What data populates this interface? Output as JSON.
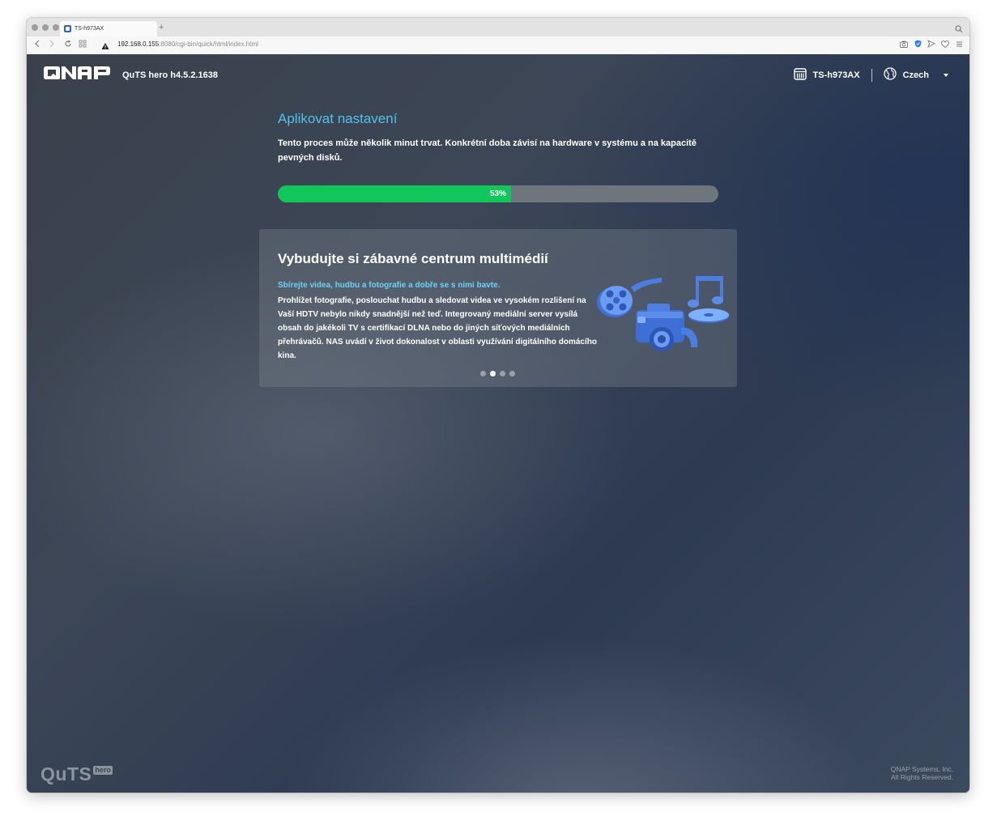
{
  "browser": {
    "tab_title": "TS-h973AX",
    "new_tab": "+",
    "url_host": "192.168.0.155",
    "url_rest": ":8080/cgi-bin/quick/html/index.html"
  },
  "header": {
    "version": "QuTS hero h4.5.2.1638",
    "device_name": "TS-h973AX",
    "language": "Czech"
  },
  "setup": {
    "title": "Aplikovat nastavení",
    "description": "Tento proces může několik minut trvat. Konkrétní doba závisí na hardware v systému a na kapacitě pevných disků.",
    "progress_percent": 53,
    "progress_label": "53%"
  },
  "carousel": {
    "title": "Vybudujte si zábavné centrum multimédií",
    "subtitle": "Sbírejte videa, hudbu a fotografie a dobře se s nimi bavte.",
    "body": "Prohlížet fotografie, poslouchat hudbu a sledovat videa ve vysokém rozlišení na Vaší HDTV nebylo nikdy snadnější než teď. Integrovaný mediální server vysílá obsah do jakékoli TV s certifikací DLNA nebo do jiných síťových mediálních přehrávačů. NAS uvádí v život dokonalost v oblasti využívání digitálního domácího kina.",
    "slide_count": 4,
    "active_slide": 2
  },
  "footer": {
    "logo_main": "QuTS",
    "logo_sub": "hero",
    "copyright_line1": "QNAP Systems, Inc.",
    "copyright_line2": "All Rights Reserved."
  },
  "colors": {
    "accent_title": "#4fc3e8",
    "progress_fill": "#11c65a",
    "progress_track": "#6f757d",
    "subtitle": "#6ad3f5"
  },
  "icons": {
    "device": "nas-device-icon",
    "language": "globe-icon",
    "art": "multimedia-illustration"
  }
}
